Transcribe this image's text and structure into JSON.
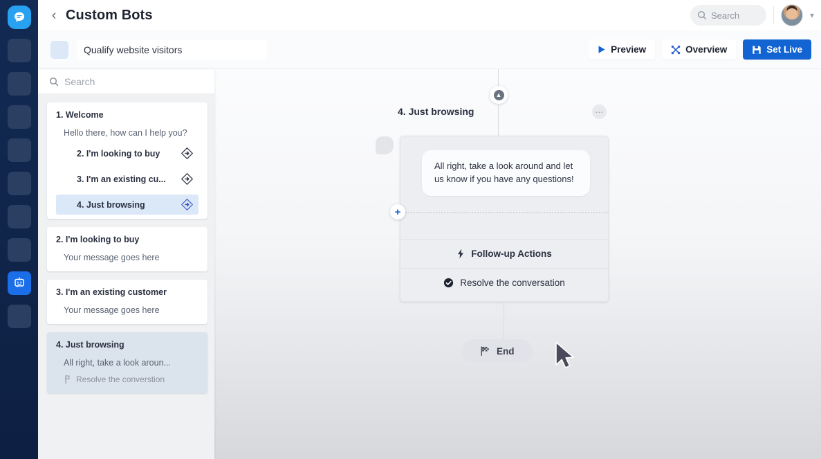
{
  "rail": {
    "logo_icon": "chat-bubble-logo",
    "items": [
      {
        "name": "rail-item-1",
        "icon": "placeholder-block"
      },
      {
        "name": "rail-item-2",
        "icon": "placeholder-block"
      },
      {
        "name": "rail-item-3",
        "icon": "placeholder-block"
      },
      {
        "name": "rail-item-4",
        "icon": "placeholder-block"
      },
      {
        "name": "rail-item-5",
        "icon": "placeholder-block"
      },
      {
        "name": "rail-item-6",
        "icon": "placeholder-block"
      },
      {
        "name": "rail-item-7",
        "icon": "placeholder-block"
      },
      {
        "name": "rail-item-bots",
        "icon": "robot-icon",
        "active": true
      },
      {
        "name": "rail-item-9",
        "icon": "placeholder-block"
      }
    ],
    "active_bg": "#1a6ee8",
    "bg": "#122a54"
  },
  "topbar": {
    "back_icon": "chevron-left-icon",
    "title": "Custom Bots",
    "search": {
      "icon": "search-icon",
      "placeholder": "Search",
      "value": ""
    },
    "avatar_icon": "user-avatar",
    "chevron_icon": "chevron-down-icon"
  },
  "toolbar": {
    "bot_icon": "bot-square-icon",
    "bot_name_value": "Qualify website visitors",
    "bot_name_placeholder": "Bot name",
    "preview_label": "Preview",
    "preview_icon": "play-icon",
    "overview_label": "Overview",
    "overview_icon": "nodes-overview-icon",
    "set_live_label": "Set Live",
    "set_live_icon": "save-disk-icon",
    "primary_color": "#1264d3"
  },
  "left_panel": {
    "search": {
      "icon": "search-icon",
      "placeholder": "Search",
      "value": ""
    },
    "cards": [
      {
        "title": "1. Welcome",
        "message": "Hello there, how can I help you?",
        "branches": [
          {
            "label": "2. I'm looking to buy",
            "icon": "branch-diamond-icon",
            "selected": false
          },
          {
            "label": "3. I'm an existing cu...",
            "icon": "branch-diamond-icon",
            "selected": false
          },
          {
            "label": "4. Just browsing",
            "icon": "branch-diamond-icon",
            "selected": true
          }
        ]
      },
      {
        "title": "2. I'm looking to buy",
        "message": "Your message goes here"
      },
      {
        "title": "3. I'm an existing customer",
        "message": "Your message goes here"
      },
      {
        "title": "4. Just browsing",
        "message": "All right, take a look aroun...",
        "action_label": "Resolve the converstion",
        "action_icon": "resolve-flag-icon",
        "selected": true
      }
    ]
  },
  "canvas": {
    "top_badge_icon": "arrow-up-circle-icon",
    "node_title": "4. Just browsing",
    "menu_icon": "ellipsis-icon",
    "avatar_placeholder_icon": "bot-avatar-placeholder",
    "bubble_text": "All right, take a look around and let us know if you have any questions!",
    "add_button_icon": "plus-icon",
    "rows": [
      {
        "label": "Follow-up Actions",
        "icon": "lightning-bolt-icon",
        "bold": true
      },
      {
        "label": "Resolve the conversation",
        "icon": "check-circle-icon",
        "bold": false
      }
    ],
    "end_label": "End",
    "end_icon": "checkered-flag-icon",
    "cursor_icon": "mouse-pointer-icon"
  }
}
